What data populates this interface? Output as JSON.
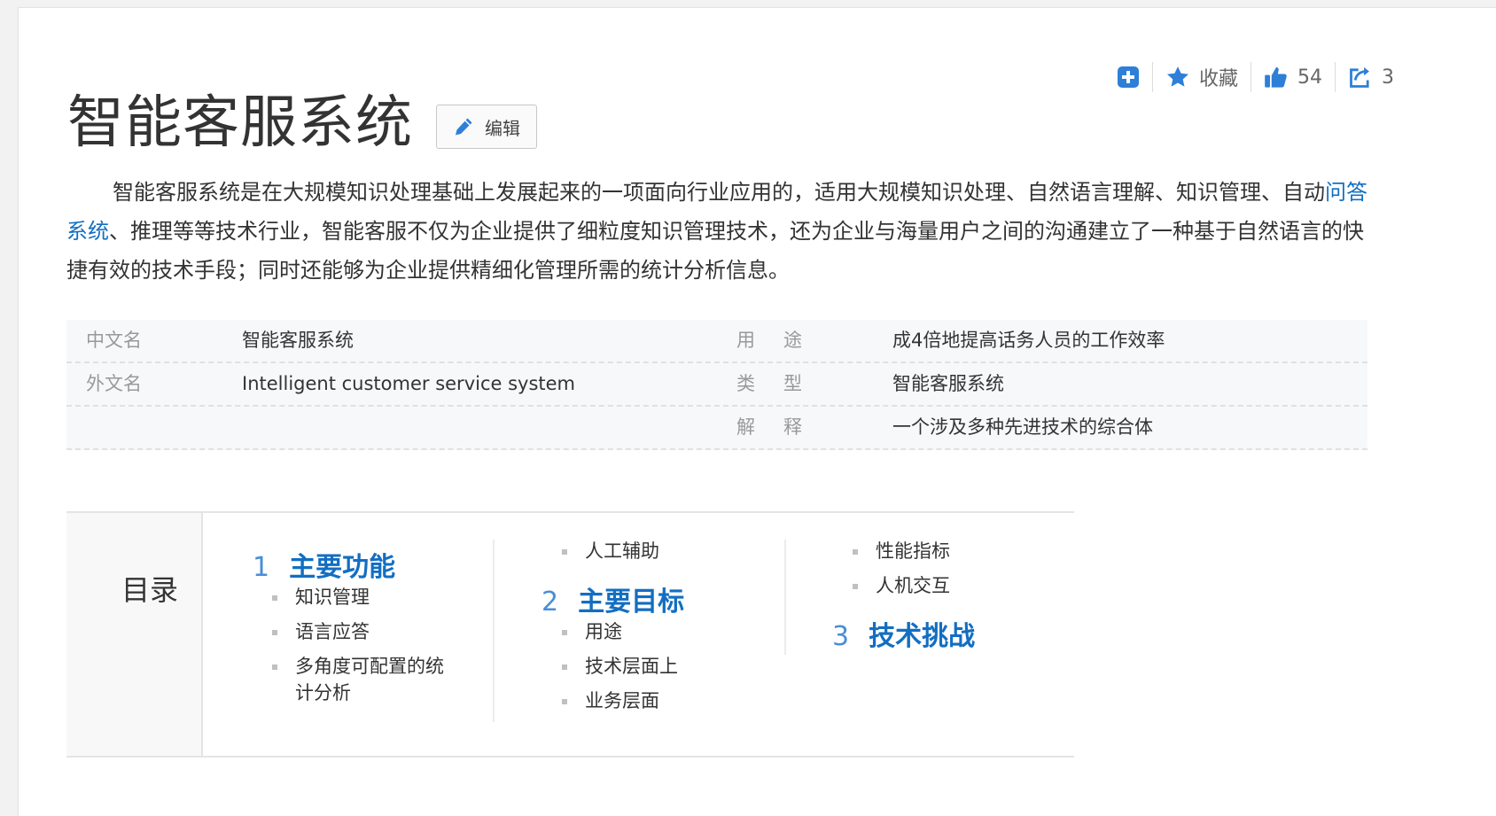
{
  "actions": {
    "favorite_label": "收藏",
    "like_count": "54",
    "share_count": "3"
  },
  "entry": {
    "title": "智能客服系统",
    "edit_label": "编辑"
  },
  "summary": {
    "part1": "智能客服系统是在大规模知识处理基础上发展起来的一项面向行业应用的，适用大规模知识处理、自然语言理解、知识管理、自动",
    "link": "问答系统",
    "part2": "、推理等等技术行业，智能客服不仅为企业提供了细粒度知识管理技术，还为企业与海量用户之间的沟通建立了一种基于自然语言的快捷有效的技术手段；同时还能够为企业提供精细化管理所需的统计分析信息。"
  },
  "basic_info": {
    "rows": [
      {
        "k1": "中文名",
        "v1": "智能客服系统",
        "k2": "用途",
        "v2": "成4倍地提高话务人员的工作效率"
      },
      {
        "k1": "外文名",
        "v1": "Intelligent customer service system",
        "k2": "类型",
        "v2": "智能客服系统"
      },
      {
        "k1": "",
        "v1": "",
        "k2": "解释",
        "v2": "一个涉及多种先进技术的综合体"
      }
    ]
  },
  "catalog": {
    "title": "目录",
    "sections": [
      {
        "num": "1",
        "title": "主要功能",
        "items": [
          "知识管理",
          "语言应答",
          "多角度可配置的统计分析",
          "人工辅助"
        ]
      },
      {
        "num": "2",
        "title": "主要目标",
        "items": [
          "用途",
          "技术层面上",
          "业务层面",
          "性能指标",
          "人机交互"
        ]
      },
      {
        "num": "3",
        "title": "技术挑战",
        "items": []
      }
    ]
  },
  "colors": {
    "link": "#136ec2",
    "icon_blue": "#2d7fd8",
    "catalog_num": "#4a8ed6"
  },
  "icons": {
    "add": "plus-square-icon",
    "favorite": "star-icon",
    "like": "thumbs-up-icon",
    "share": "share-icon",
    "edit": "pencil-icon"
  }
}
